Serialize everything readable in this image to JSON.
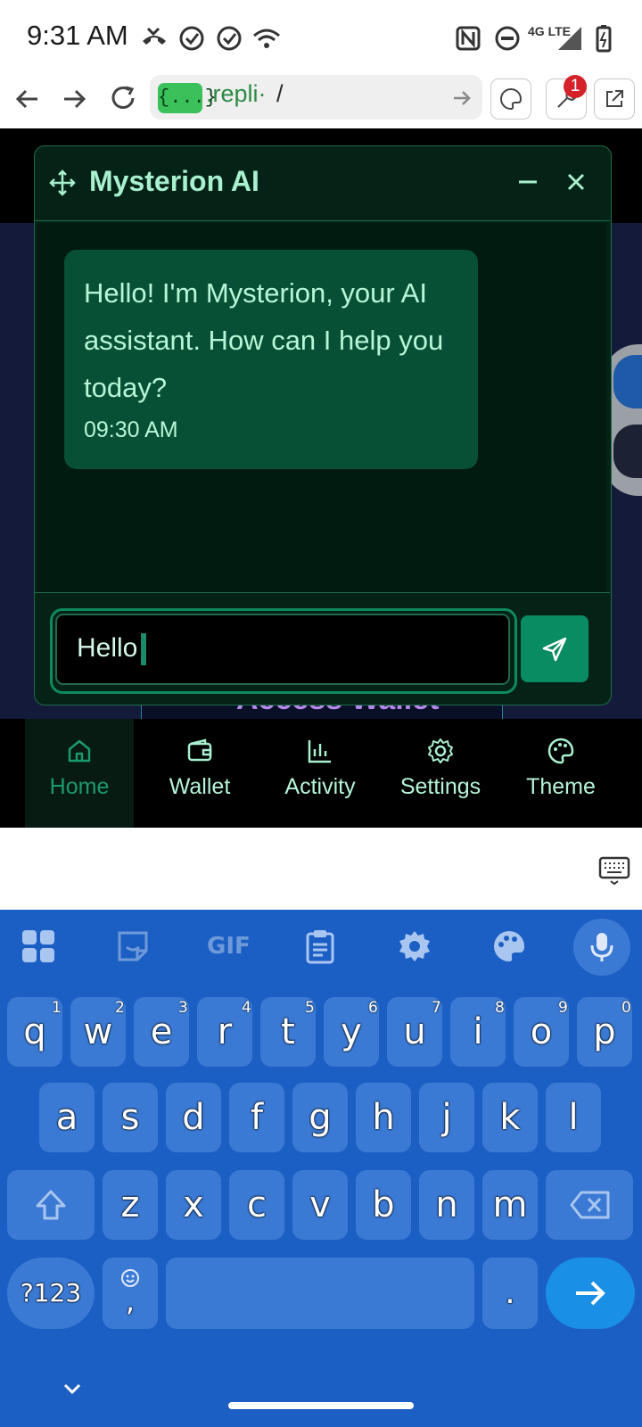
{
  "status_bar": {
    "time": "9:31 AM",
    "network": "4G LTE"
  },
  "browser": {
    "url_badge": "{...}",
    "url_host": ".repli·",
    "url_path": "/",
    "notification_count": "1"
  },
  "chat": {
    "title": "Mysterion AI",
    "messages": [
      {
        "text": "Hello! I'm Mysterion, your AI assistant. How can I help you today?",
        "time": "09:30 AM"
      }
    ],
    "input_value": "Hello"
  },
  "background_page": {
    "button_label": "Access Wallet"
  },
  "bottom_nav": {
    "items": [
      {
        "label": "Home",
        "icon": "home-icon",
        "active": true
      },
      {
        "label": "Wallet",
        "icon": "wallet-icon"
      },
      {
        "label": "Activity",
        "icon": "activity-icon"
      },
      {
        "label": "Settings",
        "icon": "settings-icon"
      },
      {
        "label": "Theme",
        "icon": "theme-icon"
      }
    ]
  },
  "keyboard": {
    "toolbar": [
      "apps-icon",
      "sticker-icon",
      "GIF",
      "clipboard-icon",
      "settings-icon",
      "palette-icon",
      "mic-icon"
    ],
    "row1": [
      "q",
      "w",
      "e",
      "r",
      "t",
      "y",
      "u",
      "i",
      "o",
      "p"
    ],
    "row1_hints": [
      "1",
      "2",
      "3",
      "4",
      "5",
      "6",
      "7",
      "8",
      "9",
      "0"
    ],
    "row2": [
      "a",
      "s",
      "d",
      "f",
      "g",
      "h",
      "j",
      "k",
      "l"
    ],
    "row3": [
      "z",
      "x",
      "c",
      "v",
      "b",
      "n",
      "m"
    ],
    "symbols_label": "?123",
    "comma": ",",
    "period": "."
  },
  "colors": {
    "accent": "#0a8c62",
    "chat_bg": "#042316",
    "bubble": "#085035",
    "keyboard_bg": "#1c5fc4",
    "key": "#3b7ad4"
  }
}
